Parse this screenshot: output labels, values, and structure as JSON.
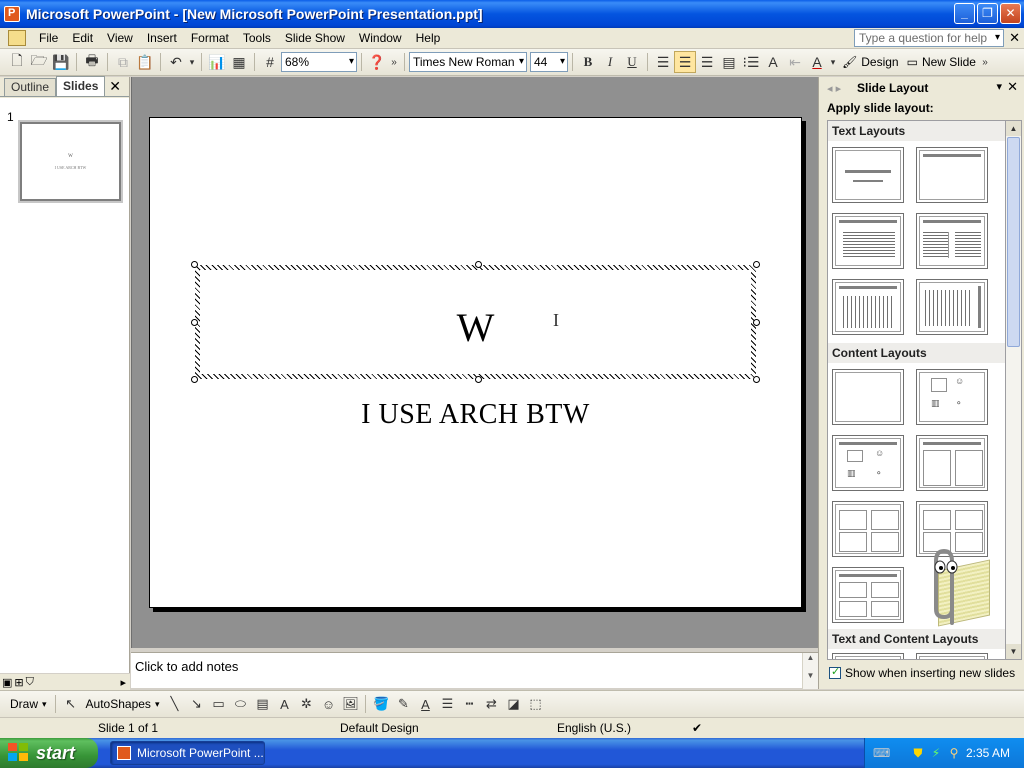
{
  "window": {
    "title": "Microsoft PowerPoint - [New Microsoft PowerPoint Presentation.ppt]",
    "controls": [
      "minimize",
      "restore",
      "close"
    ]
  },
  "menubar": {
    "items": [
      "File",
      "Edit",
      "View",
      "Insert",
      "Format",
      "Tools",
      "Slide Show",
      "Window",
      "Help"
    ],
    "help_placeholder": "Type a question for help"
  },
  "toolbar": {
    "zoom": "68%",
    "font_name": "Times New Roman",
    "font_size": "44",
    "bold_label": "B",
    "italic_label": "I",
    "underline_label": "U",
    "design_label": "Design",
    "new_slide_label": "New Slide"
  },
  "left_pane": {
    "tabs": [
      "Outline",
      "Slides"
    ],
    "active_tab": "Slides",
    "slide_number": "1",
    "thumb_title": "W",
    "thumb_subtitle": "I USE ARCH BTW"
  },
  "slide": {
    "title": "W",
    "subtitle": "I USE ARCH BTW"
  },
  "notes": {
    "placeholder": "Click to add notes"
  },
  "task_pane": {
    "title": "Slide Layout",
    "subtitle": "Apply slide layout:",
    "groups": [
      "Text Layouts",
      "Content Layouts",
      "Text and Content Layouts"
    ],
    "checkbox_label": "Show when inserting new slides",
    "checkbox_checked": true
  },
  "drawing_toolbar": {
    "draw_label": "Draw",
    "autoshapes_label": "AutoShapes"
  },
  "statusbar": {
    "slide_info": "Slide 1 of 1",
    "design": "Default Design",
    "language": "English (U.S.)"
  },
  "taskbar": {
    "start_label": "start",
    "task_button": "Microsoft PowerPoint ...",
    "clock": "2:35 AM"
  },
  "colors": {
    "titlebar": "#0046d5",
    "start_button": "#379437",
    "taskbar": "#2157d7"
  }
}
